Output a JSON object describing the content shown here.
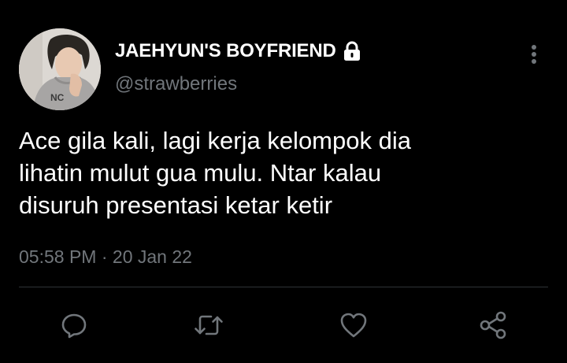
{
  "user": {
    "display_name": "JAEHYUN'S BOYFRIEND",
    "handle": "@strawberries",
    "protected_icon": "lock-icon",
    "avatar": "profile-photo"
  },
  "tweet": {
    "lines": [
      "Ace gila kali, lagi kerja kelompok dia",
      "lihatin mulut gua mulu. Ntar kalau",
      "disuruh presentasi ketar ketir"
    ],
    "time": "05:58 PM",
    "separator": "·",
    "date": "20 Jan 22"
  },
  "actions": [
    {
      "name": "reply",
      "icon": "reply-icon"
    },
    {
      "name": "retweet",
      "icon": "retweet-icon"
    },
    {
      "name": "like",
      "icon": "heart-icon"
    },
    {
      "name": "share",
      "icon": "share-icon"
    }
  ],
  "colors": {
    "background": "#000000",
    "primary_text": "#ffffff",
    "secondary_text": "#71767b",
    "divider": "#2f3336"
  }
}
